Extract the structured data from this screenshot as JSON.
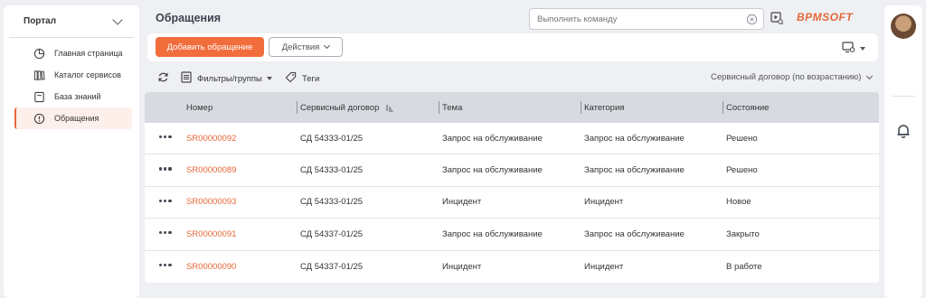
{
  "sidebar": {
    "section_title": "Портал",
    "items": [
      {
        "label": "Главная страница",
        "icon": "pie-chart-icon"
      },
      {
        "label": "Каталог сервисов",
        "icon": "catalog-icon"
      },
      {
        "label": "База знаний",
        "icon": "book-icon"
      },
      {
        "label": "Обращения",
        "icon": "alert-circle-icon",
        "active": true
      }
    ]
  },
  "header": {
    "title": "Обращения",
    "command_placeholder": "Выполнить команду",
    "logo_text": "BPMSOFT"
  },
  "toolbar": {
    "add_label": "Добавить обращение",
    "actions_label": "Действия"
  },
  "filterbar": {
    "filters_label": "Фильтры/группы",
    "tags_label": "Теги",
    "sort_label": "Сервисный договор (по возрастанию)"
  },
  "grid": {
    "columns": [
      "Номер",
      "Сервисный договор",
      "Тема",
      "Категория",
      "Состояние"
    ],
    "rows": [
      [
        "SR00000092",
        "СД 54333-01/25",
        "Запрос на обслуживание",
        "Запрос на обслуживание",
        "Решено"
      ],
      [
        "SR00000089",
        "СД 54333-01/25",
        "Запрос на обслуживание",
        "Запрос на обслуживание",
        "Решено"
      ],
      [
        "SR00000093",
        "СД 54333-01/25",
        "Инцидент",
        "Инцидент",
        "Новое"
      ],
      [
        "SR00000091",
        "СД 54337-01/25",
        "Запрос на обслуживание",
        "Запрос на обслуживание",
        "Закрыто"
      ],
      [
        "SR00000090",
        "СД 54337-01/25",
        "Инцидент",
        "Инцидент",
        "В работе"
      ]
    ]
  },
  "colors": {
    "accent": "#f16d3c",
    "link": "#e5673a",
    "header_bg": "#d7dbe1"
  }
}
